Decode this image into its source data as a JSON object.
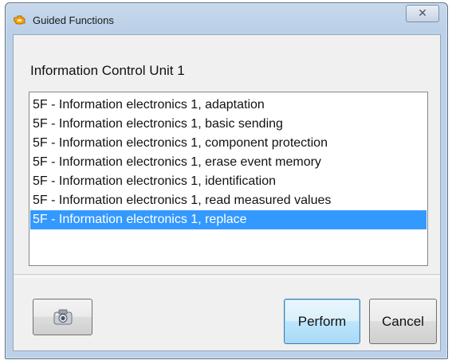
{
  "window": {
    "title": "Guided Functions",
    "close_glyph": "☒",
    "icon": "engine-warning-icon"
  },
  "main": {
    "section_title": "Information Control Unit 1",
    "list_items": [
      {
        "label": "5F - Information electronics 1, adaptation",
        "selected": false
      },
      {
        "label": "5F - Information electronics 1, basic sending",
        "selected": false
      },
      {
        "label": "5F - Information electronics 1, component protection",
        "selected": false
      },
      {
        "label": "5F - Information electronics 1, erase event memory",
        "selected": false
      },
      {
        "label": "5F - Information electronics 1, identification",
        "selected": false
      },
      {
        "label": "5F - Information electronics 1, read measured values",
        "selected": false
      },
      {
        "label": "5F - Information electronics 1, replace",
        "selected": true
      }
    ]
  },
  "buttons": {
    "camera_icon": "camera-icon",
    "perform_label": "Perform",
    "cancel_label": "Cancel"
  },
  "colors": {
    "selection": "#3399ff",
    "titlebar": "#bcd0e8",
    "client_bg": "#f0f0f0"
  }
}
